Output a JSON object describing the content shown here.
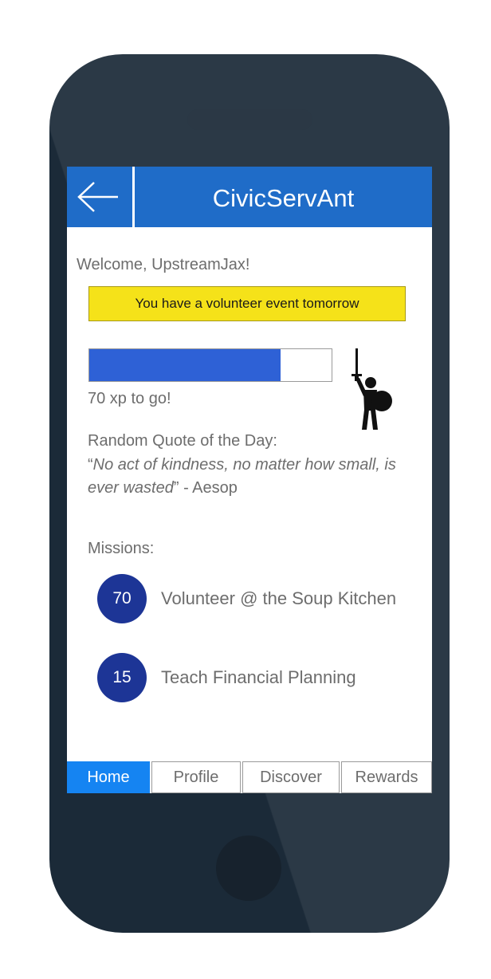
{
  "app": {
    "title": "CivicServAnt",
    "brand_color": "#1f6cc8"
  },
  "header": {
    "back_icon": "arrow-left-icon"
  },
  "welcome_text": "Welcome, UpstreamJax!",
  "alert": {
    "text": "You have a volunteer event tomorrow",
    "color": "#f5e219"
  },
  "progress": {
    "fraction": 0.79,
    "label": "70 xp to go!",
    "fill_color": "#2e61d6",
    "avatar_icon": "knight-with-sword-and-shield-icon"
  },
  "quote": {
    "heading": "Random Quote of the Day:",
    "open_mark": "“",
    "text": "No act of kindness, no matter how small, is ever wasted",
    "close_mark": "”",
    "attribution": " - Aesop"
  },
  "missions": {
    "heading": "Missions:",
    "items": [
      {
        "xp": "70",
        "label": "Volunteer @ the Soup Kitchen"
      },
      {
        "xp": "15",
        "label": "Teach Financial Planning"
      }
    ]
  },
  "tabs": [
    {
      "label": "Home",
      "active": true
    },
    {
      "label": "Profile",
      "active": false
    },
    {
      "label": "Discover",
      "active": false
    },
    {
      "label": "Rewards",
      "active": false
    }
  ]
}
